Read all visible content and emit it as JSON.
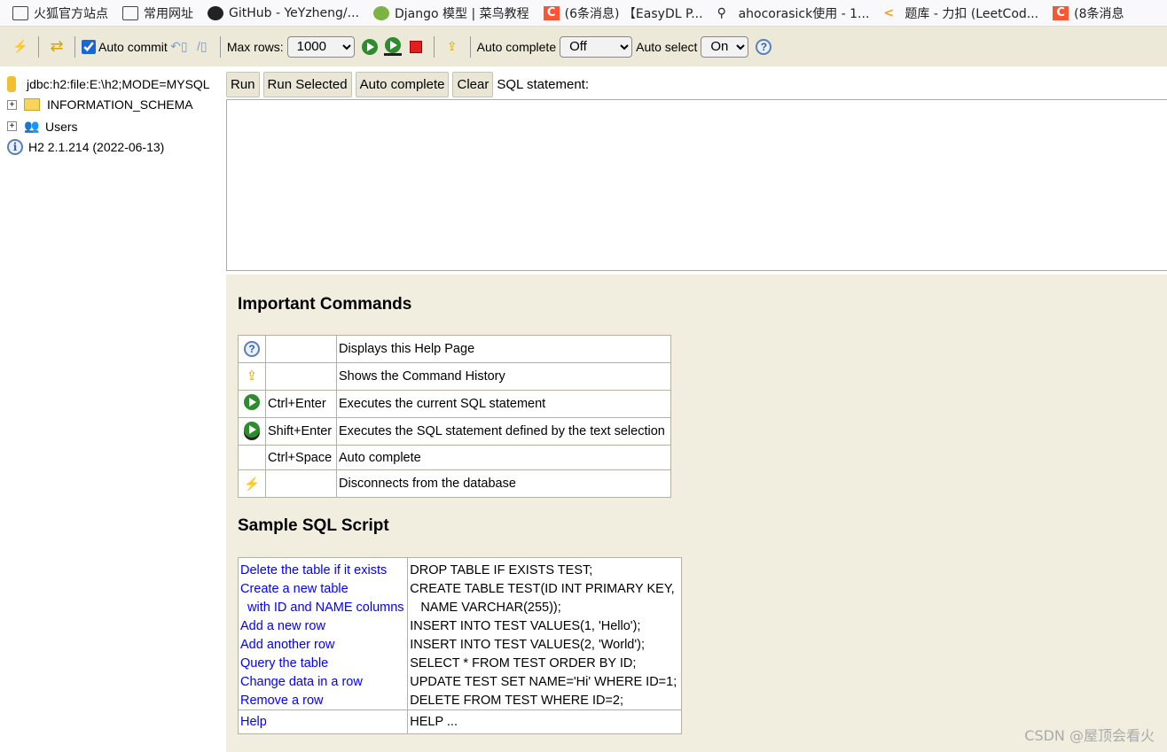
{
  "bookmarks": [
    "火狐官方站点",
    "常用网址",
    "GitHub - YeYzheng/...",
    "Django 模型 | 菜鸟教程",
    "(6条消息) 【EasyDL P...",
    "ahocorasick使用 - 1...",
    "题库 - 力扣 (LeetCod...",
    "(8条消息"
  ],
  "toolbar": {
    "auto_commit": "Auto commit",
    "auto_commit_checked": true,
    "max_rows_label": "Max rows:",
    "max_rows": "1000",
    "auto_complete_label": "Auto complete",
    "auto_complete": "Off",
    "auto_select_label": "Auto select",
    "auto_select": "On"
  },
  "tree": {
    "connection": "jdbc:h2:file:E:\\h2;MODE=MYSQL",
    "items": [
      "INFORMATION_SCHEMA",
      "Users"
    ],
    "version": "H2 2.1.214 (2022-06-13)"
  },
  "editor": {
    "run": "Run",
    "run_selected": "Run Selected",
    "auto_complete": "Auto complete",
    "clear": "Clear",
    "label": "SQL statement:",
    "value": ""
  },
  "help": {
    "commands_title": "Important Commands",
    "commands": [
      {
        "icon": "help-icon",
        "key": "",
        "desc": "Displays this Help Page"
      },
      {
        "icon": "history-icon",
        "key": "",
        "desc": "Shows the Command History"
      },
      {
        "icon": "run-icon",
        "key": "Ctrl+Enter",
        "desc": "Executes the current SQL statement"
      },
      {
        "icon": "run-selected-icon",
        "key": "Shift+Enter",
        "desc": "Executes the SQL statement defined by the text selection"
      },
      {
        "icon": "",
        "key": "Ctrl+Space",
        "desc": "Auto complete"
      },
      {
        "icon": "disconnect-icon",
        "key": "",
        "desc": "Disconnects from the database"
      }
    ],
    "sample_title": "Sample SQL Script",
    "sample": [
      {
        "label": "Delete the table if it exists",
        "sql": "DROP TABLE IF EXISTS TEST;"
      },
      {
        "label": "Create a new table",
        "sql": "CREATE TABLE TEST(ID INT PRIMARY KEY,"
      },
      {
        "label": "  with ID and NAME columns",
        "sql": "   NAME VARCHAR(255));"
      },
      {
        "label": "Add a new row",
        "sql": "INSERT INTO TEST VALUES(1, 'Hello');"
      },
      {
        "label": "Add another row",
        "sql": "INSERT INTO TEST VALUES(2, 'World');"
      },
      {
        "label": "Query the table",
        "sql": "SELECT * FROM TEST ORDER BY ID;"
      },
      {
        "label": "Change data in a row",
        "sql": "UPDATE TEST SET NAME='Hi' WHERE ID=1;"
      },
      {
        "label": "Remove a row",
        "sql": "DELETE FROM TEST WHERE ID=2;"
      },
      {
        "label": "Help",
        "sql": "HELP ..."
      }
    ]
  },
  "watermark": "CSDN @屋顶会看火"
}
